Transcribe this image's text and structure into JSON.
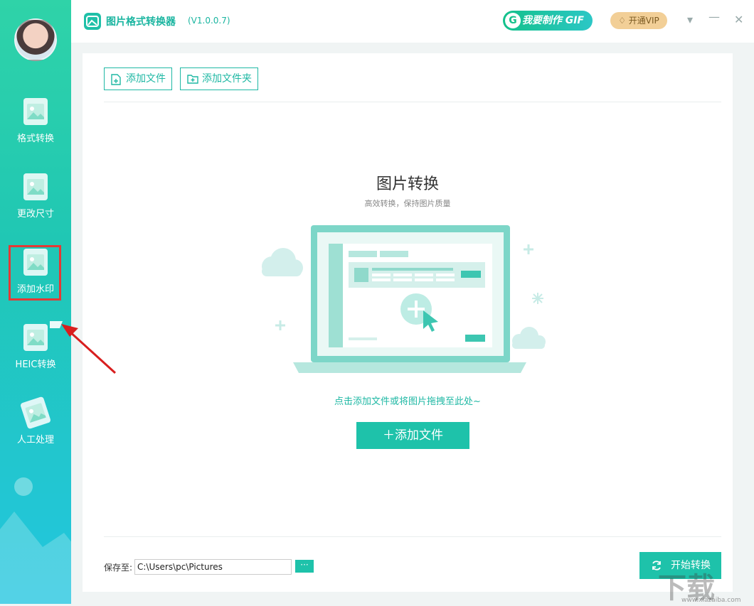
{
  "app": {
    "title": "图片格式转换器",
    "version": "(V1.0.0.7)",
    "gif_button": "我要制作 GIF",
    "gif_icon": "G",
    "vip_button": "开通VIP"
  },
  "window_controls": {
    "menu": "▾",
    "minimize": "—",
    "close": "✕"
  },
  "sidebar": {
    "items": [
      {
        "label": "格式转换",
        "icon": "image-convert-icon"
      },
      {
        "label": "更改尺寸",
        "icon": "image-resize-icon"
      },
      {
        "label": "添加水印",
        "icon": "watermark-icon",
        "highlighted": true
      },
      {
        "label": "HEIC转换",
        "icon": "heic-icon"
      },
      {
        "label": "人工处理",
        "icon": "manual-process-icon"
      }
    ]
  },
  "toolbar": {
    "add_file": "添加文件",
    "add_folder": "添加文件夹"
  },
  "main": {
    "title": "图片转换",
    "subtitle": "高效转换，保持图片质量",
    "drop_hint": "点击添加文件或将图片拖拽至此处~",
    "add_file_button": "＋添加文件"
  },
  "footer": {
    "save_label": "保存至:",
    "save_path": "C:\\Users\\pc\\Pictures",
    "browse_button": "···",
    "start_button": "开始转换"
  },
  "watermark": {
    "logo": "下载",
    "url": "www.xiazaiba.com"
  },
  "colors": {
    "accent": "#1ec2aa",
    "highlight_box": "#e53935",
    "vip": "#f2cf97"
  }
}
